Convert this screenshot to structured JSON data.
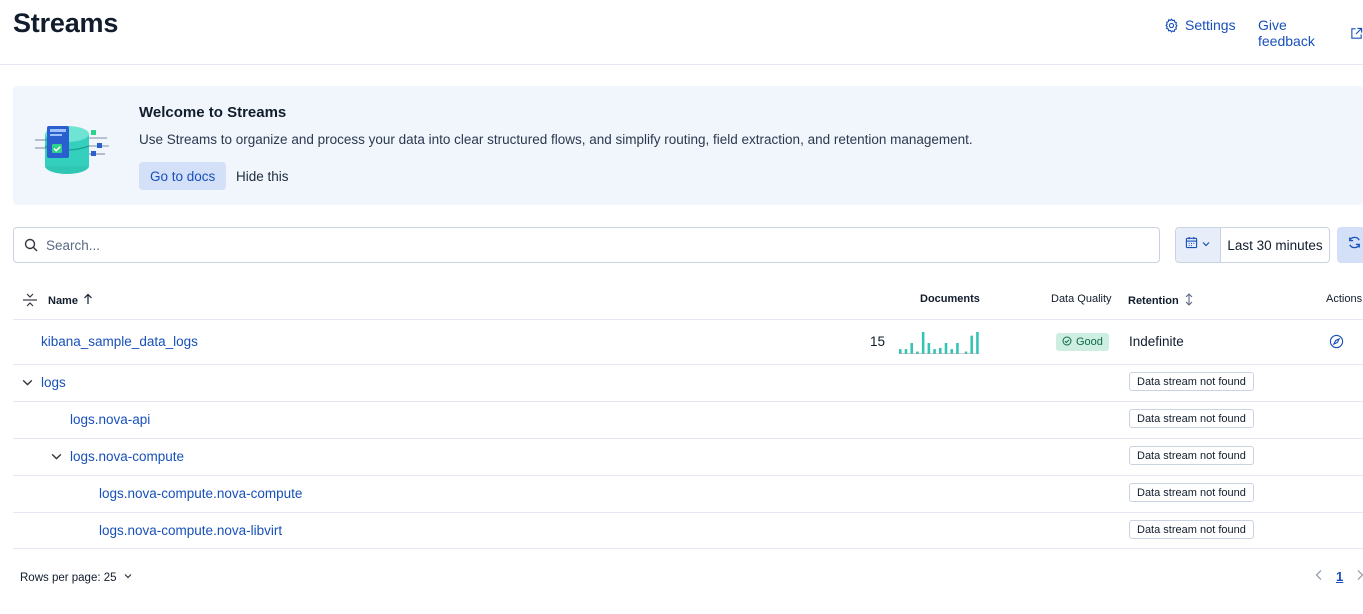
{
  "header": {
    "title": "Streams",
    "settings_label": "Settings",
    "feedback_label": "Give feedback"
  },
  "callout": {
    "title": "Welcome to Streams",
    "text": "Use Streams to organize and process your data into clear structured flows, and simplify routing, field extraction, and retention management.",
    "docs_button": "Go to docs",
    "hide_button": "Hide this"
  },
  "search": {
    "placeholder": "Search...",
    "value": ""
  },
  "date_picker": {
    "label": "Last 30 minutes"
  },
  "table": {
    "columns": {
      "name": "Name",
      "documents": "Documents",
      "data_quality": "Data Quality",
      "retention": "Retention",
      "actions": "Actions"
    },
    "rows": [
      {
        "name": "kibana_sample_data_logs",
        "documents": "15",
        "sparkline": [
          4,
          0,
          4,
          0,
          9,
          0,
          2,
          0,
          18,
          0,
          9,
          0,
          4,
          0,
          5,
          0,
          9,
          0,
          4,
          0,
          9,
          0,
          0,
          2,
          0,
          15,
          0,
          18
        ],
        "quality": "Good",
        "retention": "Indefinite"
      },
      {
        "name": "logs",
        "status": "Data stream not found"
      },
      {
        "name": "logs.nova-api",
        "status": "Data stream not found"
      },
      {
        "name": "logs.nova-compute",
        "status": "Data stream not found"
      },
      {
        "name": "logs.nova-compute.nova-compute",
        "status": "Data stream not found"
      },
      {
        "name": "logs.nova-compute.nova-libvirt",
        "status": "Data stream not found"
      }
    ]
  },
  "footer": {
    "rows_per_page": "Rows per page: 25",
    "current_page": "1"
  },
  "colors": {
    "link": "#1750ba",
    "accent_bg": "#d3e0f8",
    "callout_bg": "#f1f5fc",
    "sparkline": "#35c3b3",
    "good_bg": "#cdeee0"
  }
}
